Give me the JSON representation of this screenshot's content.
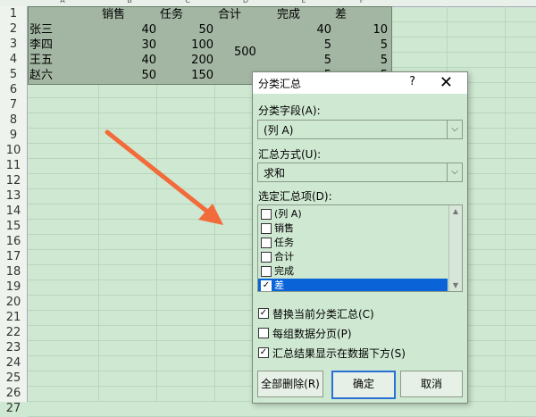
{
  "columns": {
    "a": "A",
    "b": "B",
    "c": "C",
    "d": "D",
    "e": "E",
    "f": "F"
  },
  "rows": [
    "1",
    "2",
    "3",
    "4",
    "5",
    "6",
    "7",
    "8",
    "9",
    "10",
    "11",
    "12",
    "13",
    "14",
    "15",
    "16",
    "17",
    "18",
    "19",
    "20",
    "21",
    "22",
    "23",
    "24",
    "25",
    "26",
    "27"
  ],
  "table": {
    "headers": {
      "sales": "销售",
      "task": "任务",
      "total": "合计",
      "done": "完成",
      "diff": "差"
    },
    "names": [
      "张三",
      "李四",
      "王五",
      "赵六"
    ],
    "sales": [
      "40",
      "30",
      "40",
      "50"
    ],
    "task": [
      "50",
      "100",
      "200",
      "150"
    ],
    "total_merged": "500",
    "done": [
      "40",
      "5",
      "5",
      "5"
    ],
    "diff": [
      "10",
      "5",
      "5",
      "5"
    ]
  },
  "dialog": {
    "title": "分类汇总",
    "help": "?",
    "close": "✕",
    "group_field_label": "分类字段(A):",
    "group_field_value": "(列 A)",
    "summary_label": "汇总方式(U):",
    "summary_value": "求和",
    "items_label": "选定汇总项(D):",
    "items": [
      {
        "label": "(列 A)",
        "checked": false
      },
      {
        "label": "销售",
        "checked": false
      },
      {
        "label": "任务",
        "checked": false
      },
      {
        "label": "合计",
        "checked": false
      },
      {
        "label": "完成",
        "checked": false
      },
      {
        "label": "差",
        "checked": true
      }
    ],
    "options": {
      "replace": {
        "label": "替换当前分类汇总(C)",
        "checked": true
      },
      "pagebreak": {
        "label": "每组数据分页(P)",
        "checked": false
      },
      "below": {
        "label": "汇总结果显示在数据下方(S)",
        "checked": true
      }
    },
    "buttons": {
      "remove_all": "全部删除(R)",
      "ok": "确定",
      "cancel": "取消"
    }
  },
  "colors": {
    "arrow": "#f26b3a",
    "selection": "#0a64d8"
  }
}
